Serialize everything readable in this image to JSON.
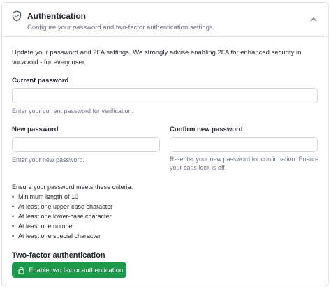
{
  "section": {
    "title": "Authentication",
    "subtitle": "Configure your password and two-factor authentication settings.",
    "icon": "shield-icon",
    "collapse_icon": "chevron-up-icon"
  },
  "intro": "Update your password and 2FA settings. We strongly advise enabling 2FA for enhanced security in vucavoid - for every user.",
  "current_password": {
    "label": "Current password",
    "value": "",
    "placeholder": "",
    "help": "Enter your current password for verification."
  },
  "new_password": {
    "label": "New password",
    "value": "",
    "placeholder": "",
    "help": "Enter your new password."
  },
  "confirm_password": {
    "label": "Confirm new password",
    "value": "",
    "placeholder": "",
    "help": "Re-enter your new password for confirmation. Ensure your caps lock is off."
  },
  "criteria": {
    "heading": "Ensure your password meets these criteria:",
    "items": [
      "Minimum length of 10",
      "At least one upper-case character",
      "At least one lower-case character",
      "At least one number",
      "At least one special character"
    ]
  },
  "two_factor": {
    "title": "Two-factor authentication",
    "button_label": "Enable two factor authentication",
    "button_icon": "lock-icon",
    "button_color": "#1a9a4a"
  }
}
